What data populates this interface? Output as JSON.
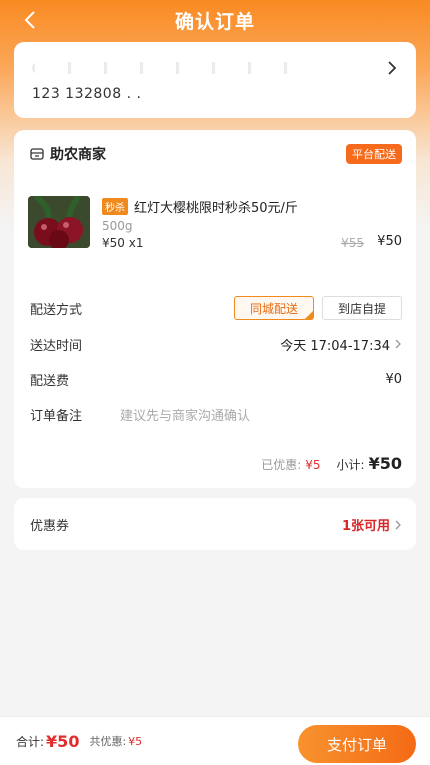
{
  "header": {
    "title": "确认订单"
  },
  "address": {
    "phone": "123  132808 . ."
  },
  "shop": {
    "name": "助农商家",
    "badge": "平台配送"
  },
  "product": {
    "tag": "秒杀",
    "title": "红灯大樱桃限时秒杀50元/斤",
    "spec": "500g",
    "price_qty": "¥50  x1",
    "original_price": "¥55",
    "price": "¥50"
  },
  "delivery": {
    "method_label": "配送方式",
    "options": [
      "同城配送",
      "到店自提"
    ],
    "time_label": "送达时间",
    "time_value": "今天 17:04-17:34",
    "fee_label": "配送费",
    "fee_value": "¥0",
    "note_label": "订单备注",
    "note_placeholder": "建议先与商家沟通确认"
  },
  "summary": {
    "discount_label": "已优惠:",
    "discount_value": "¥5",
    "subtotal_label": "小计:",
    "subtotal_value": "¥50"
  },
  "coupon": {
    "label": "优惠券",
    "value": "1张可用"
  },
  "bottom": {
    "total_label": "合计:",
    "total_value": "¥50",
    "discount_label": "共优惠:",
    "discount_value": "¥5",
    "pay_label": "支付订单"
  },
  "colors": {
    "accent": "#f46b15",
    "price_red": "#e02d2d"
  }
}
